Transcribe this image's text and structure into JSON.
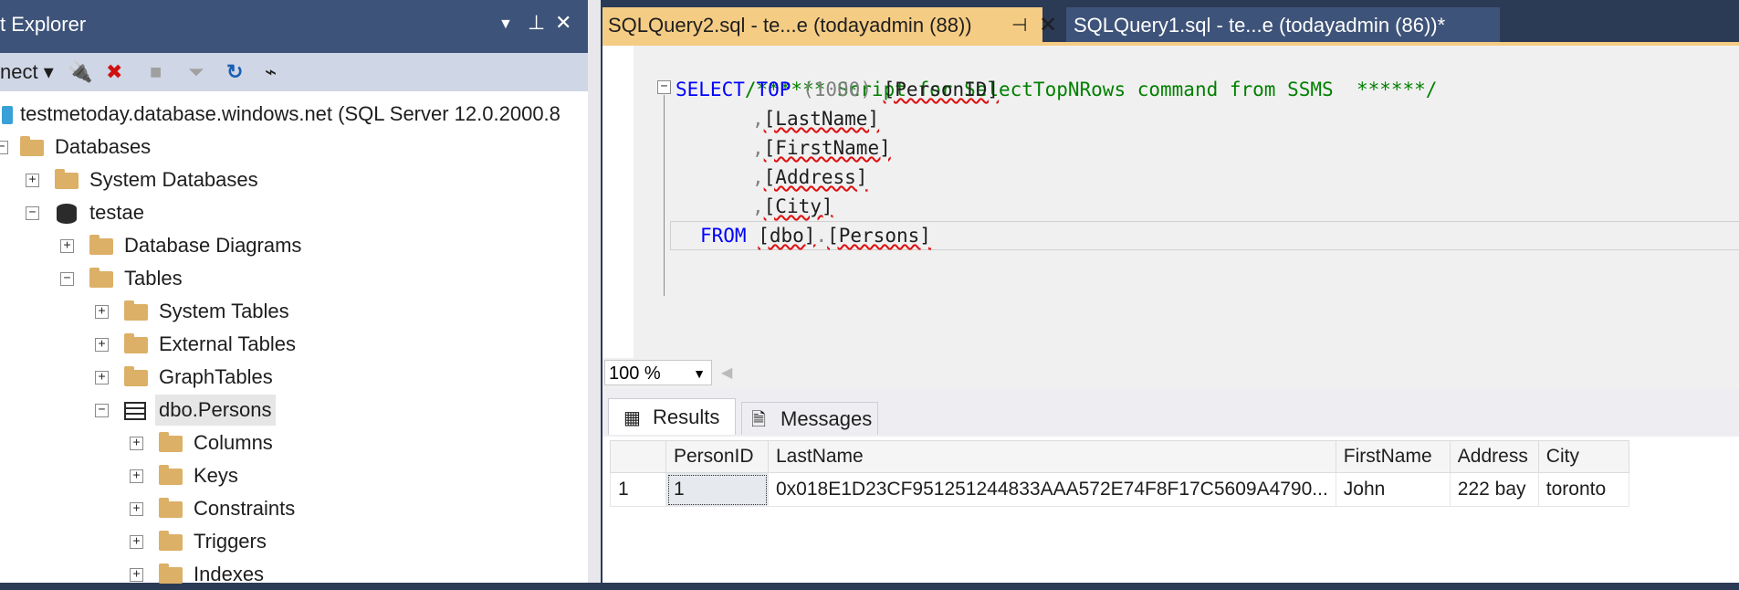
{
  "object_explorer": {
    "title": "t Explorer",
    "toolbar": {
      "connect_label": "nect"
    },
    "tree": {
      "server": "testmetoday.database.windows.net (SQL Server 12.0.2000.8",
      "databases": "Databases",
      "system_databases": "System Databases",
      "testae": "testae",
      "database_diagrams": "Database Diagrams",
      "tables": "Tables",
      "system_tables": "System Tables",
      "external_tables": "External Tables",
      "graph_tables": "GraphTables",
      "dbo_persons": "dbo.Persons",
      "columns": "Columns",
      "keys": "Keys",
      "constraints": "Constraints",
      "triggers": "Triggers",
      "indexes": "Indexes"
    }
  },
  "tabs": {
    "active": "SQLQuery2.sql - te...e (todayadmin (88))",
    "inactive": "SQLQuery1.sql - te...e (todayadmin (86))*"
  },
  "editor": {
    "comment": "/****** Script for SelectTopNRows command from SSMS  ******/",
    "select_kw": "SELECT",
    "top_kw": "TOP",
    "top_n": "(1000)",
    "col1": "[PersonID]",
    "col2": "[LastName]",
    "col3": "[FirstName]",
    "col4": "[Address]",
    "col5": "[City]",
    "comma": ",",
    "from_kw": "FROM",
    "schema": "[dbo]",
    "dot": ".",
    "table": "[Persons]"
  },
  "zoom": {
    "value": "100 %"
  },
  "results": {
    "tabs": {
      "results": "Results",
      "messages": "Messages"
    },
    "columns": [
      "PersonID",
      "LastName",
      "FirstName",
      "Address",
      "City"
    ],
    "rows": [
      {
        "num": "1",
        "PersonID": "1",
        "LastName": "0x018E1D23CF951251244833AAA572E74F8F17C5609A4790...",
        "FirstName": "John",
        "Address": "222 bay",
        "City": "toronto"
      }
    ]
  }
}
